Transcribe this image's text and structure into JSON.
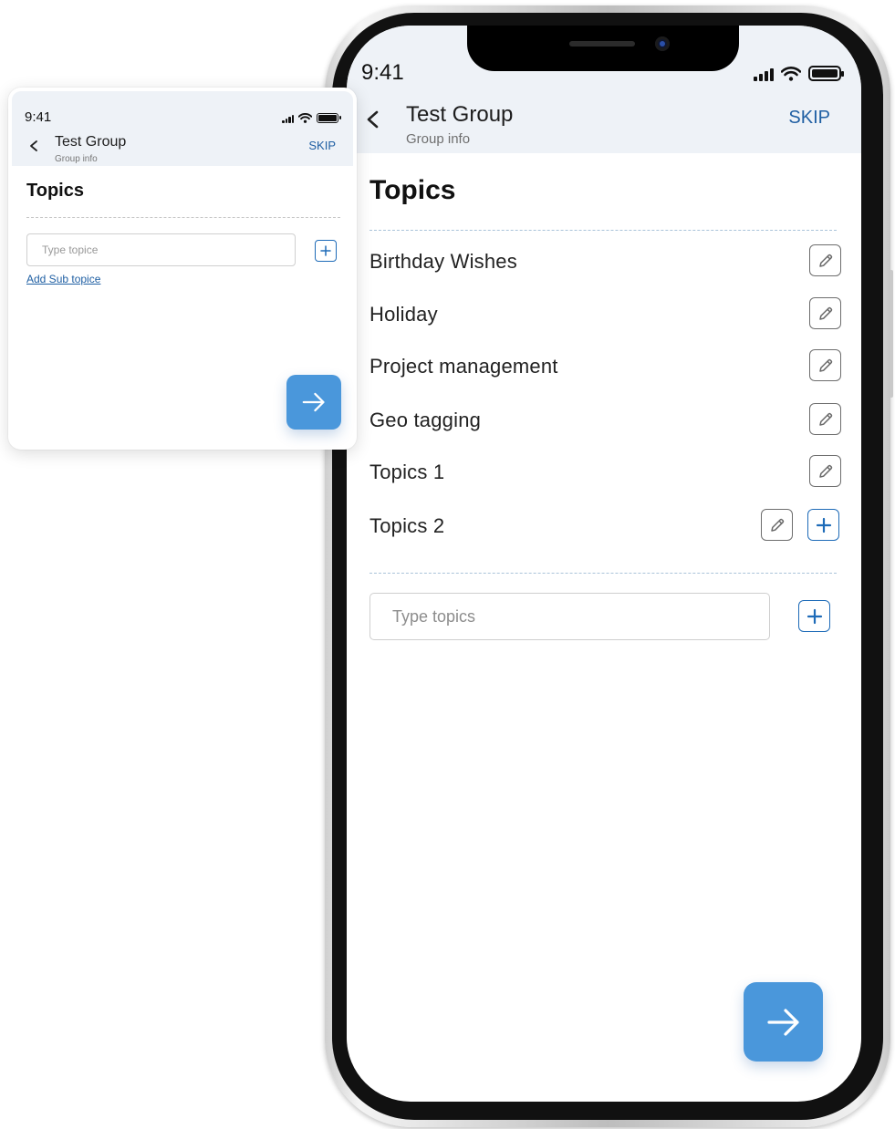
{
  "phone": {
    "status_bar": {
      "time": "9:41"
    },
    "header": {
      "title": "Test Group",
      "subtitle": "Group info",
      "skip_label": "SKIP",
      "back_icon": "chevron-left-icon"
    },
    "heading": "Topics",
    "topics": [
      {
        "label": "Birthday Wishes",
        "has_add": false
      },
      {
        "label": "Holiday",
        "has_add": false
      },
      {
        "label": "Project management",
        "has_add": false
      },
      {
        "label": "Geo tagging",
        "has_add": false
      },
      {
        "label": "Topics 1",
        "has_add": false
      },
      {
        "label": "Topics 2",
        "has_add": true
      }
    ],
    "input": {
      "placeholder": "Type topics",
      "value": ""
    },
    "next_icon": "arrow-right-icon"
  },
  "card": {
    "status_bar": {
      "time": "9:41"
    },
    "header": {
      "title": "Test Group",
      "subtitle": "Group info",
      "skip_label": "SKIP",
      "back_icon": "chevron-left-icon"
    },
    "heading": "Topics",
    "input": {
      "placeholder": "Type topice",
      "value": ""
    },
    "add_sub_link": "Add Sub topice",
    "next_icon": "arrow-right-icon"
  },
  "colors": {
    "accent": "#4a97db",
    "link": "#1f5fa3",
    "header_bg": "#eef2f7",
    "add_border": "#1e6bb8"
  }
}
